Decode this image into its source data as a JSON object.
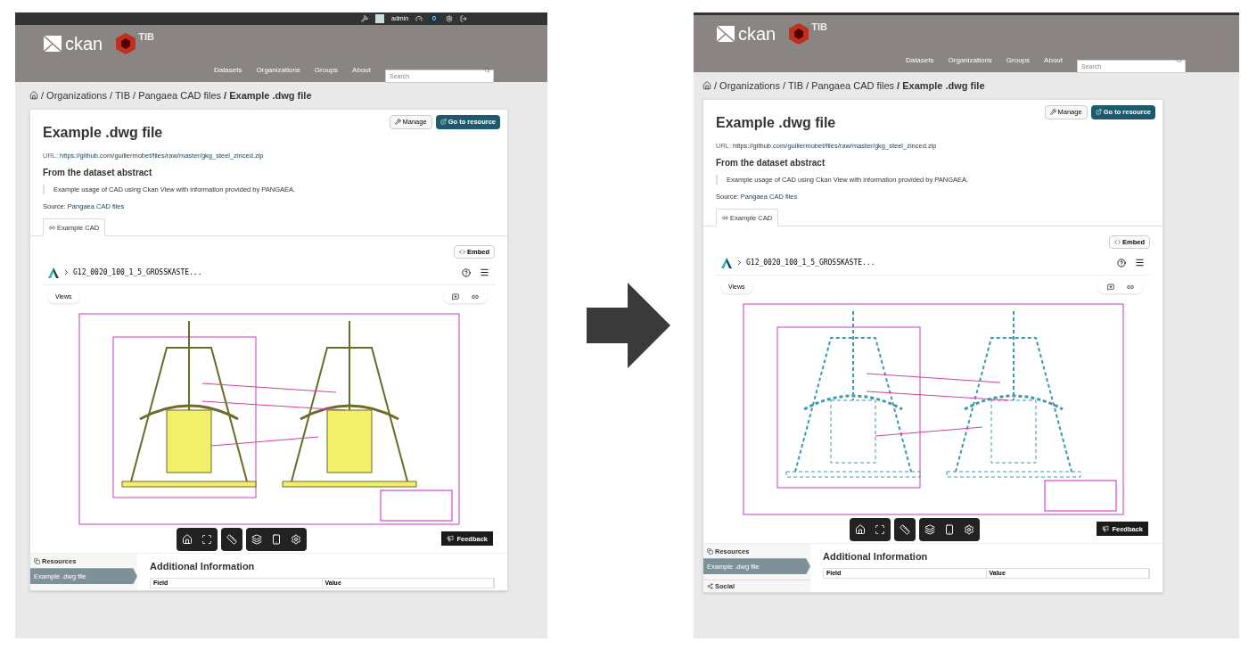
{
  "screens": [
    {
      "admin_bar": {
        "user": "admin",
        "badge": "0"
      },
      "logo": "ckan",
      "partner": "TIB",
      "drawing": {
        "kind": "color"
      },
      "nav": [
        "Datasets",
        "Organizations",
        "Groups",
        "About"
      ],
      "search": {
        "placeholder": "Search"
      },
      "breadcrumb": [
        "/ Organizations",
        "/ TIB",
        "/ Pangaea CAD files",
        "/ Example .dwg file"
      ],
      "title": "Example .dwg file",
      "manage": "Manage",
      "go": "Go to resource",
      "url_label": "URL:",
      "url": "https://github.com/guillermobet/files/raw/master/gkg_steel_zinced.zip",
      "abstract_heading": "From the dataset abstract",
      "abstract": "Example usage of CAD using Ckan View with information provided by PANGAEA.",
      "source_label": "Source:",
      "source": "Pangaea CAD files",
      "tab": "Example CAD",
      "embed": "Embed",
      "file": "G12_0020_100_1_5_GROSSKASTE...",
      "views": "Views",
      "feedback": "Feedback",
      "resources": "Resources",
      "resource_items": [
        {
          "label": "Example .dwg file",
          "selected": true
        }
      ],
      "info_heading": "Additional Information",
      "columns": [
        "Field",
        "Value"
      ]
    },
    {
      "logo": "ckan",
      "partner": "TIB",
      "drawing": {
        "kind": "wireframe"
      },
      "nav": [
        "Datasets",
        "Organizations",
        "Groups",
        "About"
      ],
      "search": {
        "placeholder": "Search"
      },
      "breadcrumb": [
        "/ Organizations",
        "/ TIB",
        "/ Pangaea CAD files",
        "/ Example .dwg file"
      ],
      "title": "Example .dwg file",
      "manage": "Manage",
      "go": "Go to resource",
      "url_label": "URL:",
      "url": "https://github.com/guillermobet/files/raw/master/gkg_steel_zinced.zip",
      "abstract_heading": "From the dataset abstract",
      "abstract": "Example usage of CAD using Ckan View with information provided by PANGAEA.",
      "source_label": "Source:",
      "source": "Pangaea CAD files",
      "tab": "Example CAD",
      "embed": "Embed",
      "file": "G12_0020_100_1_5_GROSSKASTE...",
      "views": "Views",
      "feedback": "Feedback",
      "resources": "Resources",
      "resource_items": [
        {
          "label": "Example .dwg file",
          "selected": true
        }
      ],
      "social": "Social",
      "info_heading": "Additional Information",
      "columns": [
        "Field",
        "Value"
      ]
    }
  ]
}
